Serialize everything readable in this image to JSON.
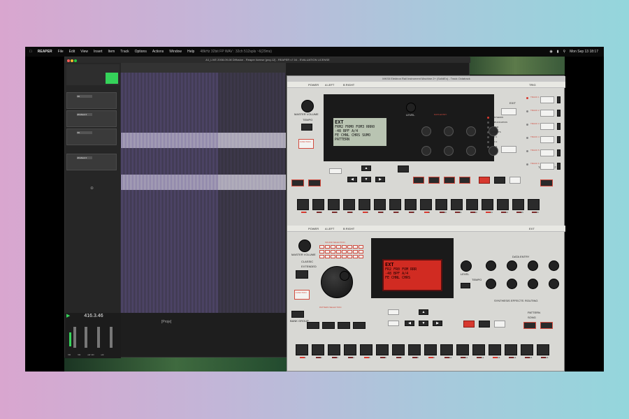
{
  "menubar": {
    "app": "REAPER",
    "items": [
      "File",
      "Edit",
      "View",
      "Insert",
      "Item",
      "Track",
      "Options",
      "Actions",
      "Window",
      "Help"
    ],
    "status_text": "48kHz 32bit FP WAV : 32ch 512spls ~6(29ms)",
    "clock": "Mon Sep 13 18:17"
  },
  "reaper": {
    "window_title": "A1_LIVE 2008-09-08 Diffusion - Reaper license [proj-12] - REAPER v7.04 - EVALUATION LICENSE",
    "tracks": [
      {
        "name": "VD",
        "color": "#3aa3d8"
      },
      {
        "name": "ultrabeat 2",
        "color": "#3aa3d8"
      },
      {
        "name": "VD",
        "color": "#3aa3d8"
      },
      {
        "name": "ultrabeat 2",
        "color": "#3aa3d8"
      }
    ],
    "time": "416.3.46",
    "project_label": "[Proje]",
    "mixer_labels": [
      "VD",
      "VD",
      "ultr VD",
      "ultr"
    ]
  },
  "plugin": {
    "window_title": "MKS5 Elektron Rail Instrument Machine 2+ (SolidEx) - Track Octatrack",
    "top": {
      "header": [
        "POWER",
        "A LEFT",
        "B RIGHT",
        "1",
        "2",
        "3",
        "4",
        "5",
        "6",
        "IN",
        "CH1",
        "TRIG"
      ],
      "master_volume": "MASTER VOLUME",
      "tempo": "TEMPO",
      "function": "FUNCTION",
      "level": "LEVEL",
      "data_entry": "DATA ENTRY",
      "exit": "EXIT",
      "lcd_lines": [
        "EXT",
        "FRM2 FRM0 FOM3 RRR0",
        "-48 BPF A/4",
        "FE CHNL CHRS SUMO",
        "PATTERN",
        "SAW FILTER"
      ],
      "mode_leds": [
        "SYNTHESIS",
        "AMPLIFICATION",
        "FILTER",
        "EFFECTS",
        "LFO 1",
        "LFO 2",
        "LFO 3"
      ],
      "sub_labels": [
        "PATTERN",
        "KIT",
        "SONG"
      ],
      "buttons_left": [
        "GLOBAL",
        "KIT"
      ],
      "buttons_mid": [
        "ARP",
        "TRANSPOSE",
        "SWING",
        "SCALE"
      ],
      "buttons_right": [
        "COPY",
        "CLEAR",
        "PASTE"
      ],
      "track_labels": [
        "TRACK 1",
        "TRACK 2",
        "TRACK 3",
        "TRACK 4",
        "TRACK 5",
        "TRACK 6"
      ],
      "trig_select": "TRIG SELECT",
      "extra": [
        "ARP",
        "FILTER",
        "ENV",
        "LFO"
      ],
      "pad_numbers": [
        "1",
        "2",
        "3",
        "4",
        "5",
        "6",
        "7",
        "8",
        "9",
        "10",
        "11",
        "12",
        "13",
        "14",
        "15",
        "16"
      ]
    },
    "bottom": {
      "header": [
        "POWER",
        "A LEFT",
        "B RIGHT",
        "",
        "",
        "",
        "",
        "",
        "IN",
        "OUT",
        "TRIG",
        "",
        "",
        "",
        "EXT"
      ],
      "master_volume": "MASTER VOLUME",
      "sound_selection": "SOUND SELECTION",
      "classic": "CLASSIC",
      "extended": "EXTENDED",
      "function": "FUNCTION",
      "level": "LEVEL",
      "tempo": "TEMPO",
      "data_entry": "DATA ENTRY",
      "lcd_lines": [
        "EXT",
        "FR2 FR0 FOM RRR",
        "-48 BPF A/4",
        "FE CHNL CHRS"
      ],
      "pattern_selection": "PATTERN SELECTION",
      "bank_group": "BANK GROUP",
      "mode_labels": [
        "SYNTHESIS",
        "EFFECTS",
        "ROUTING"
      ],
      "buttons": [
        "MUTE",
        "ACCENT",
        "SWING",
        "SLIDE"
      ],
      "buttons_right": [
        "COPY",
        "CLEAR",
        "PASTE"
      ],
      "pattern_song": [
        "PATTERN",
        "SONG"
      ],
      "global": "GLOBAL",
      "pad_numbers": [
        "1",
        "2",
        "3",
        "4",
        "5",
        "6",
        "7",
        "8",
        "9",
        "10",
        "11",
        "12",
        "13",
        "14",
        "15",
        "16"
      ]
    }
  },
  "colors": {
    "accent_red": "#d7392f",
    "lcd_green": "#b9c4b2",
    "lcd_red": "#d12b22",
    "reaper_bg": "#1e1e1e",
    "track_green": "#35d35a"
  }
}
